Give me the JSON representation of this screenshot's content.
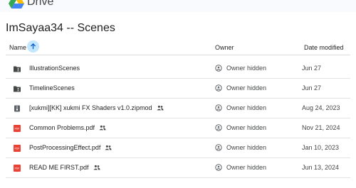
{
  "app": {
    "name": "Drive"
  },
  "folder": {
    "title": "ImSayaa34 -- Scenes"
  },
  "columns": {
    "name": "Name",
    "owner": "Owner",
    "date": "Date modified"
  },
  "colors": {
    "folder_icon": "#444746",
    "zip_icon": "#5f6368",
    "pdf_icon": "#ea4335",
    "sort_accent": "#c2e7ff"
  },
  "files": [
    {
      "name": "IllustrationScenes",
      "type": "folder-icon",
      "shared": false,
      "owner": "Owner hidden",
      "date": "Jun 27"
    },
    {
      "name": "TimelineScenes",
      "type": "folder-icon",
      "shared": false,
      "owner": "Owner hidden",
      "date": "Jun 27"
    },
    {
      "name": "[xukmi][KK] xukmi FX Shaders v1.0.zipmod",
      "type": "archive-icon",
      "shared": true,
      "owner": "Owner hidden",
      "date": "Aug 24, 2023"
    },
    {
      "name": "Common Problems.pdf",
      "type": "pdf-icon",
      "shared": true,
      "owner": "Owner hidden",
      "date": "Nov 21, 2024"
    },
    {
      "name": "PostProcessingEffect.pdf",
      "type": "pdf-icon",
      "shared": true,
      "owner": "Owner hidden",
      "date": "Jan 10, 2023"
    },
    {
      "name": "READ ME FIRST.pdf",
      "type": "pdf-icon",
      "shared": true,
      "owner": "Owner hidden",
      "date": "Jun 13, 2024"
    }
  ]
}
